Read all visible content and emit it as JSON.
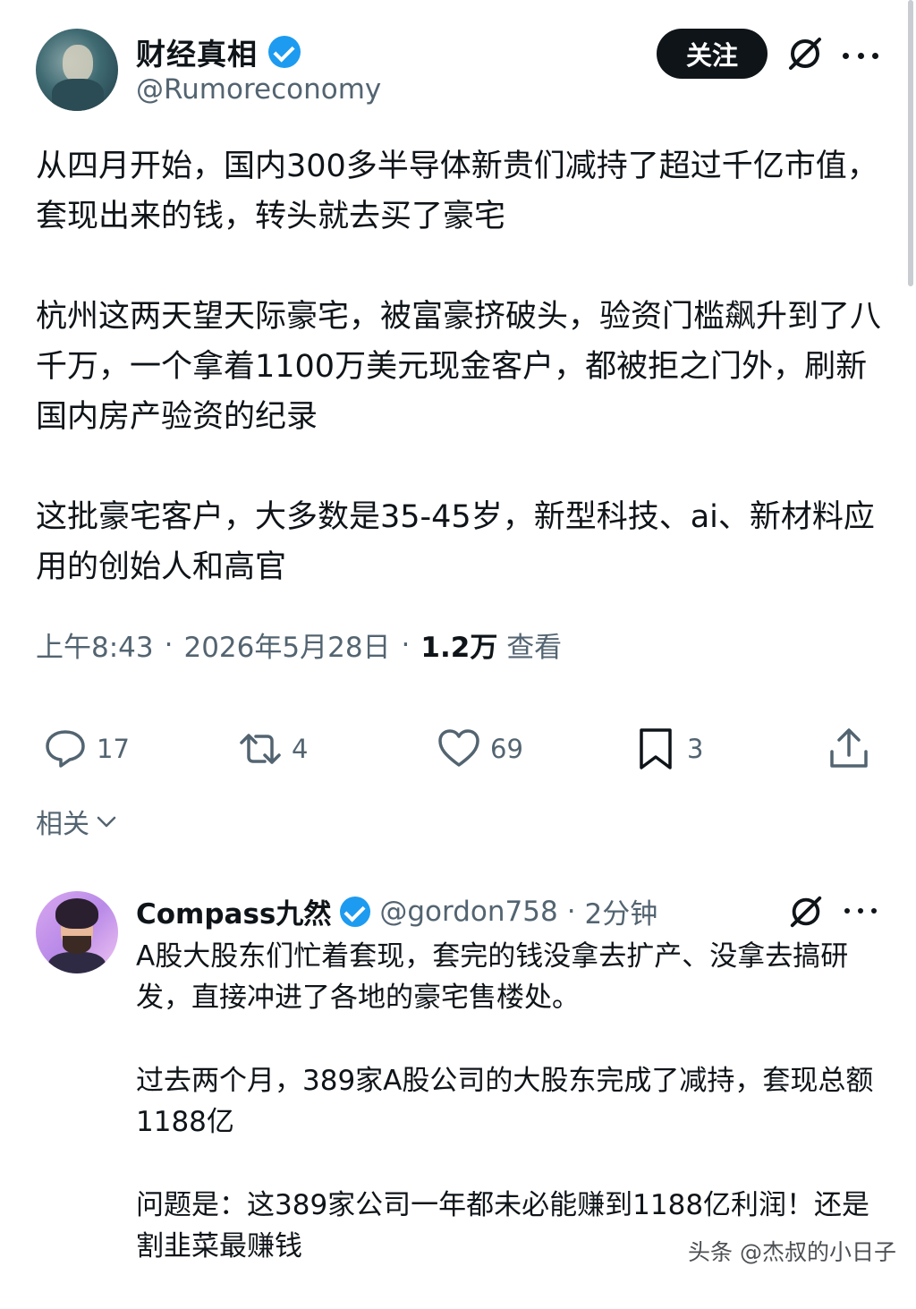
{
  "tweet": {
    "author": {
      "display_name": "财经真相",
      "handle": "@Rumoreconomy",
      "avatar_icon": "avatar-portrait",
      "verified_color": "#1d9bf0"
    },
    "follow_label": "关注",
    "paragraphs": [
      "从四月开始，国内300多半导体新贵们减持了超过千亿市值，套现出来的钱，转头就去买了豪宅",
      "杭州这两天望天际豪宅，被富豪挤破头，验资门槛飙升到了八千万，一个拿着1100万美元现金客户，都被拒之门外，刷新国内房产验资的纪录",
      "这批豪宅客户，大多数是35-45岁，新型科技、ai、新材料应用的创始人和高官"
    ],
    "meta": {
      "time": "上午8:43",
      "date": "2026年5月28日",
      "views_count": "1.2万",
      "views_label": "查看"
    },
    "actions": {
      "replies": "17",
      "retweets": "4",
      "likes": "69",
      "bookmarks": "3"
    }
  },
  "related_label": "相关",
  "reply": {
    "author": {
      "display_name": "Compass九然",
      "handle": "@gordon758",
      "time_ago": "2分钟"
    },
    "paragraphs": [
      "A股大股东们忙着套现，套完的钱没拿去扩产、没拿去搞研发，直接冲进了各地的豪宅售楼处。",
      "过去两个月，389家A股公司的大股东完成了减持，套现总额1188亿",
      "问题是：这389家公司一年都未必能赚到1188亿利润！还是割韭菜最赚钱"
    ]
  },
  "watermark": "头条 @杰叔的小日子",
  "colors": {
    "text_primary": "#0f1419",
    "text_secondary": "#536471",
    "accent": "#1d9bf0",
    "button_bg": "#0f1419"
  }
}
